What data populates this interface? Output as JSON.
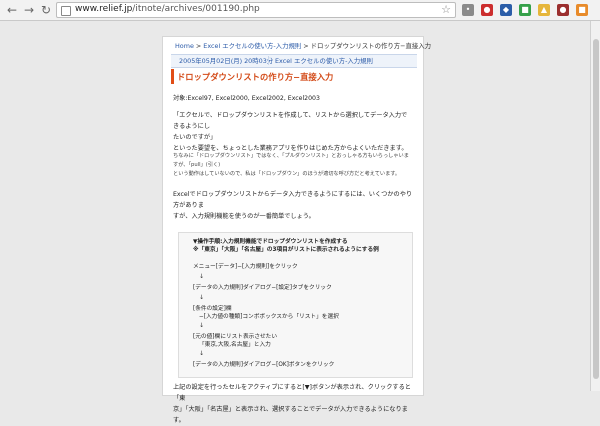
{
  "browser": {
    "back_symbol": "←",
    "forward_symbol": "→",
    "reload_symbol": "↻",
    "url_host": "www.relief.jp",
    "url_path": "/itnote/archives/001190.php",
    "star_symbol": "☆",
    "extension_icons": [
      {
        "name": "ext-icon-1",
        "color": "#8b8b8b",
        "label": "•"
      },
      {
        "name": "ext-icon-2",
        "color": "#cc2e2e",
        "label": "●"
      },
      {
        "name": "ext-icon-3",
        "color": "#2c5ea8",
        "label": "◆"
      },
      {
        "name": "ext-icon-4",
        "color": "#36a14a",
        "label": "■"
      },
      {
        "name": "ext-icon-5",
        "color": "#e6b63b",
        "label": "▲"
      },
      {
        "name": "ext-icon-6",
        "color": "#9b2f2f",
        "label": "●"
      },
      {
        "name": "ext-icon-7",
        "color": "#e88b2a",
        "label": "■"
      }
    ]
  },
  "breadcrumb": {
    "home": "Home",
    "sep": " > ",
    "category": "Excel エクセルの使い方-入力規則",
    "current": "ドロップダウンリストの作り方−直接入力"
  },
  "meta": {
    "date": "2005年05月02日(月) 20時03分",
    "category": "Excel エクセルの使い方-入力規則"
  },
  "article": {
    "title": "ドロップダウンリストの作り方−直接入力",
    "target": "対象:Excel97, Excel2000, Excel2002, Excel2003",
    "p1_line1": "「エクセルで、ドロップダウンリストを作成して、リストから選択してデータ入力できるようにし",
    "p1_line2": "たいのですが」",
    "p1_line3": "といった要望を、ちょっとした業務アプリを作りはじめた方からよくいただきます。",
    "note_line1": "ちなみに「ドロップダウンリスト」ではなく、「プルダウンリスト」とおっしゃる方もいらっしゃいますが、「pull」(引く)",
    "note_line2": "という動作はしていないので、私は「ドロップダウン」のほうが適切な呼び方だと考えています。",
    "p2_line1": "Excelでドロップダウンリストからデータ入力できるようにするには、いくつかのやり方がありま",
    "p2_line2": "すが、入力規則機能を使うのが一番簡単でしょう。",
    "quote": {
      "line1": "▼操作手順:入力規則機能でドロップダウンリストを作成する",
      "line2": "※「東京」「大阪」「名古屋」の3項目がリストに表示されるようにする例",
      "line3": "メニュー[データ]−[入力規則]をクリック",
      "line4": "[データの入力規則]ダイアログ−[設定]タブをクリック",
      "line5": "[条件の設定]欄",
      "line6": "−[入力値の種類]コンボボックスから「リスト」を選択",
      "line7": "[元の値]欄にリスト表示させたい",
      "line8": "「東京,大阪,名古屋」と入力",
      "line9": "[データの入力規則]ダイアログ−[OK]ボタンをクリック",
      "arrow": "↓"
    },
    "p3_line1": "上記の設定を行ったセルをアクティブにすると[▼]ボタンが表示され、クリックすると「東",
    "p3_line2": "京」「大阪」「名古屋」と表示され、選択することでデータが入力できるようになります。"
  }
}
